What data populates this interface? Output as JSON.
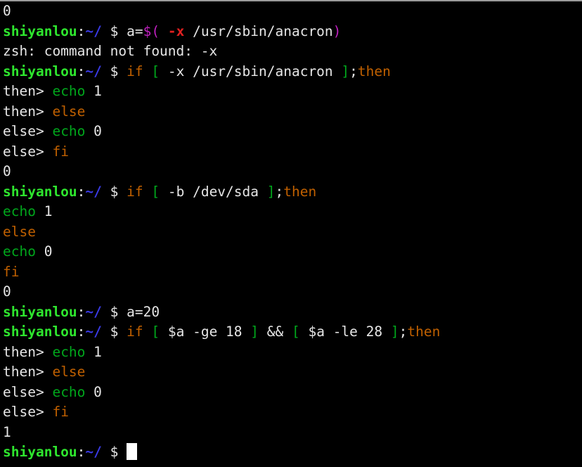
{
  "terminal": {
    "shell": "zsh",
    "hostname": "shiyanlou",
    "cwd": "~/",
    "prompt_symbol": "$",
    "colors": {
      "background": "#000000",
      "foreground": "#e6e6e6",
      "prompt_host": "#2ee62e",
      "prompt_path": "#3a3ae6",
      "keyword": "#c06000",
      "builtin": "#00a81c",
      "bracket": "#00a81c",
      "substitution": "#c020c0",
      "error_arg": "#e02020",
      "cursor": "#ffffff",
      "top_border": "#9a9a9a"
    },
    "cursor_visible": true,
    "lines": [
      {
        "id": "line-1",
        "kind": "output",
        "text": "0",
        "segments": [
          {
            "t": "0",
            "c": "c-white"
          }
        ]
      },
      {
        "id": "line-2",
        "kind": "command",
        "text": "shiyanlou:~/ $ a=$( -x /usr/sbin/anacron)",
        "segments": [
          {
            "t": "shiyanlou",
            "c": "c-brgreen"
          },
          {
            "t": ":",
            "c": "c-white"
          },
          {
            "t": "~/",
            "c": "c-blue"
          },
          {
            "t": " $ ",
            "c": "c-white"
          },
          {
            "t": "a=",
            "c": "c-white"
          },
          {
            "t": "$(",
            "c": "c-magenta"
          },
          {
            "t": " ",
            "c": "c-white"
          },
          {
            "t": "-x",
            "c": "c-red"
          },
          {
            "t": " /usr/sbin/anacron",
            "c": "c-white"
          },
          {
            "t": ")",
            "c": "c-magenta"
          }
        ]
      },
      {
        "id": "line-3",
        "kind": "output",
        "text": "zsh: command not found: -x",
        "segments": [
          {
            "t": "zsh: command not found: -x",
            "c": "c-white"
          }
        ]
      },
      {
        "id": "line-4",
        "kind": "command",
        "text": "shiyanlou:~/ $ if [ -x /usr/sbin/anacron ];then",
        "segments": [
          {
            "t": "shiyanlou",
            "c": "c-brgreen"
          },
          {
            "t": ":",
            "c": "c-white"
          },
          {
            "t": "~/",
            "c": "c-blue"
          },
          {
            "t": " $ ",
            "c": "c-white"
          },
          {
            "t": "if",
            "c": "c-orange"
          },
          {
            "t": " ",
            "c": "c-white"
          },
          {
            "t": "[",
            "c": "c-brackgrn"
          },
          {
            "t": " -x /usr/sbin/anacron ",
            "c": "c-white"
          },
          {
            "t": "]",
            "c": "c-brackgrn"
          },
          {
            "t": ";",
            "c": "c-white"
          },
          {
            "t": "then",
            "c": "c-orange"
          }
        ]
      },
      {
        "id": "line-5",
        "kind": "continuation",
        "text": "then> echo 1",
        "segments": [
          {
            "t": "then> ",
            "c": "c-white"
          },
          {
            "t": "echo",
            "c": "c-green"
          },
          {
            "t": " 1",
            "c": "c-white"
          }
        ]
      },
      {
        "id": "line-6",
        "kind": "continuation",
        "text": "then> else",
        "segments": [
          {
            "t": "then> ",
            "c": "c-white"
          },
          {
            "t": "else",
            "c": "c-orange"
          }
        ]
      },
      {
        "id": "line-7",
        "kind": "continuation",
        "text": "else> echo 0",
        "segments": [
          {
            "t": "else> ",
            "c": "c-white"
          },
          {
            "t": "echo",
            "c": "c-green"
          },
          {
            "t": " 0",
            "c": "c-white"
          }
        ]
      },
      {
        "id": "line-8",
        "kind": "continuation",
        "text": "else> fi",
        "segments": [
          {
            "t": "else> ",
            "c": "c-white"
          },
          {
            "t": "fi",
            "c": "c-orange"
          }
        ]
      },
      {
        "id": "line-9",
        "kind": "output",
        "text": "0",
        "segments": [
          {
            "t": "0",
            "c": "c-white"
          }
        ]
      },
      {
        "id": "line-10",
        "kind": "command",
        "text": "shiyanlou:~/ $ if [ -b /dev/sda ];then",
        "segments": [
          {
            "t": "shiyanlou",
            "c": "c-brgreen"
          },
          {
            "t": ":",
            "c": "c-white"
          },
          {
            "t": "~/",
            "c": "c-blue"
          },
          {
            "t": " $ ",
            "c": "c-white"
          },
          {
            "t": "if",
            "c": "c-orange"
          },
          {
            "t": " ",
            "c": "c-white"
          },
          {
            "t": "[",
            "c": "c-brackgrn"
          },
          {
            "t": " -b /dev/sda ",
            "c": "c-white"
          },
          {
            "t": "]",
            "c": "c-brackgrn"
          },
          {
            "t": ";",
            "c": "c-white"
          },
          {
            "t": "then",
            "c": "c-orange"
          }
        ]
      },
      {
        "id": "line-11",
        "kind": "continuation",
        "text": "echo 1",
        "segments": [
          {
            "t": "echo",
            "c": "c-green"
          },
          {
            "t": " 1",
            "c": "c-white"
          }
        ]
      },
      {
        "id": "line-12",
        "kind": "continuation",
        "text": "else",
        "segments": [
          {
            "t": "else",
            "c": "c-orange"
          }
        ]
      },
      {
        "id": "line-13",
        "kind": "continuation",
        "text": "echo 0",
        "segments": [
          {
            "t": "echo",
            "c": "c-green"
          },
          {
            "t": " 0",
            "c": "c-white"
          }
        ]
      },
      {
        "id": "line-14",
        "kind": "continuation",
        "text": "fi",
        "segments": [
          {
            "t": "fi",
            "c": "c-orange"
          }
        ]
      },
      {
        "id": "line-15",
        "kind": "output",
        "text": "0",
        "segments": [
          {
            "t": "0",
            "c": "c-white"
          }
        ]
      },
      {
        "id": "line-16",
        "kind": "command",
        "text": "shiyanlou:~/ $ a=20",
        "segments": [
          {
            "t": "shiyanlou",
            "c": "c-brgreen"
          },
          {
            "t": ":",
            "c": "c-white"
          },
          {
            "t": "~/",
            "c": "c-blue"
          },
          {
            "t": " $ ",
            "c": "c-white"
          },
          {
            "t": "a=20",
            "c": "c-white"
          }
        ]
      },
      {
        "id": "line-17",
        "kind": "command",
        "text": "shiyanlou:~/ $ if [ $a -ge 18 ] && [ $a -le 28 ];then",
        "segments": [
          {
            "t": "shiyanlou",
            "c": "c-brgreen"
          },
          {
            "t": ":",
            "c": "c-white"
          },
          {
            "t": "~/",
            "c": "c-blue"
          },
          {
            "t": " $ ",
            "c": "c-white"
          },
          {
            "t": "if",
            "c": "c-orange"
          },
          {
            "t": " ",
            "c": "c-white"
          },
          {
            "t": "[",
            "c": "c-brackgrn"
          },
          {
            "t": " $a -ge 18 ",
            "c": "c-white"
          },
          {
            "t": "]",
            "c": "c-brackgrn"
          },
          {
            "t": " && ",
            "c": "c-white"
          },
          {
            "t": "[",
            "c": "c-brackgrn"
          },
          {
            "t": " $a -le 28 ",
            "c": "c-white"
          },
          {
            "t": "]",
            "c": "c-brackgrn"
          },
          {
            "t": ";",
            "c": "c-white"
          },
          {
            "t": "then",
            "c": "c-orange"
          }
        ]
      },
      {
        "id": "line-18",
        "kind": "continuation",
        "text": "then> echo 1",
        "segments": [
          {
            "t": "then> ",
            "c": "c-white"
          },
          {
            "t": "echo",
            "c": "c-green"
          },
          {
            "t": " 1",
            "c": "c-white"
          }
        ]
      },
      {
        "id": "line-19",
        "kind": "continuation",
        "text": "then> else",
        "segments": [
          {
            "t": "then> ",
            "c": "c-white"
          },
          {
            "t": "else",
            "c": "c-orange"
          }
        ]
      },
      {
        "id": "line-20",
        "kind": "continuation",
        "text": "else> echo 0",
        "segments": [
          {
            "t": "else> ",
            "c": "c-white"
          },
          {
            "t": "echo",
            "c": "c-green"
          },
          {
            "t": " 0",
            "c": "c-white"
          }
        ]
      },
      {
        "id": "line-21",
        "kind": "continuation",
        "text": "else> fi",
        "segments": [
          {
            "t": "else> ",
            "c": "c-white"
          },
          {
            "t": "fi",
            "c": "c-orange"
          }
        ]
      },
      {
        "id": "line-22",
        "kind": "output",
        "text": "1",
        "segments": [
          {
            "t": "1",
            "c": "c-white"
          }
        ]
      },
      {
        "id": "line-23",
        "kind": "prompt",
        "text": "shiyanlou:~/ $ ",
        "segments": [
          {
            "t": "shiyanlou",
            "c": "c-brgreen"
          },
          {
            "t": ":",
            "c": "c-white"
          },
          {
            "t": "~/",
            "c": "c-blue"
          },
          {
            "t": " $ ",
            "c": "c-white"
          }
        ],
        "cursor": true
      }
    ]
  }
}
